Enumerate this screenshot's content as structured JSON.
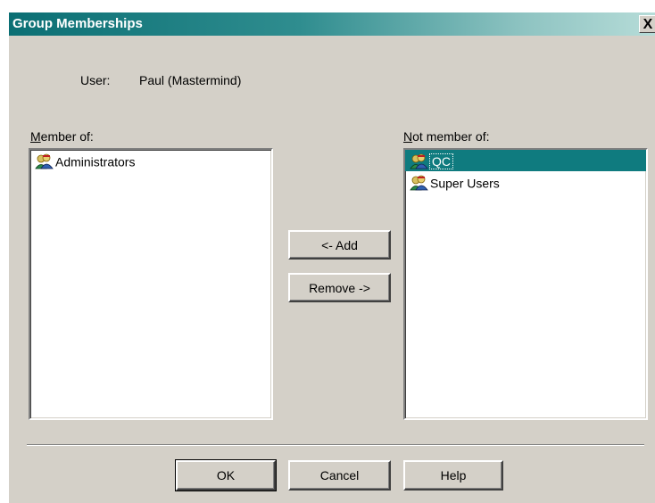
{
  "window": {
    "title": "Group Memberships",
    "close_label": "X"
  },
  "user": {
    "label": "User:",
    "value": "Paul (Mastermind)"
  },
  "member_of": {
    "label": "Member of:",
    "items": [
      {
        "label": "Administrators",
        "icon": "user-group-icon"
      }
    ]
  },
  "not_member_of": {
    "label": "Not member of:",
    "items": [
      {
        "label": "QC",
        "icon": "user-group-icon",
        "selected": true
      },
      {
        "label": "Super Users",
        "icon": "user-group-icon"
      }
    ]
  },
  "buttons": {
    "add": "<- Add",
    "remove": "Remove ->",
    "ok": "OK",
    "cancel": "Cancel",
    "help": "Help"
  },
  "colors": {
    "selection": "#0f7b7f",
    "dialog_bg": "#d4d0c8"
  }
}
